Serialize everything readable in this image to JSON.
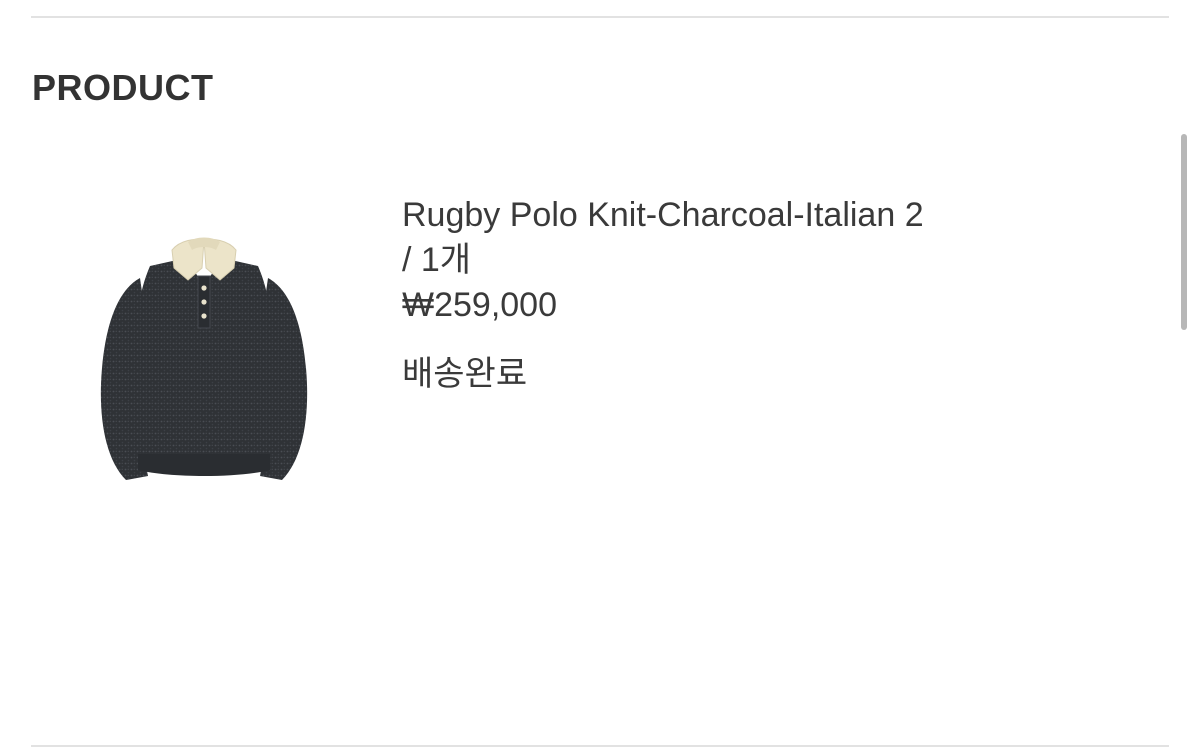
{
  "section": {
    "title": "PRODUCT"
  },
  "product": {
    "name": "Rugby Polo Knit-Charcoal-Italian 2",
    "quantity": "/ 1개",
    "price": "₩259,000",
    "status": "배송완료",
    "image_icon": "sweater-image",
    "colors": {
      "body": "#2f3236",
      "collar": "#ece4c9"
    }
  },
  "colors": {
    "text": "#333333",
    "divider": "#e2e2e2",
    "scrollbar": "#b7b7b7"
  }
}
